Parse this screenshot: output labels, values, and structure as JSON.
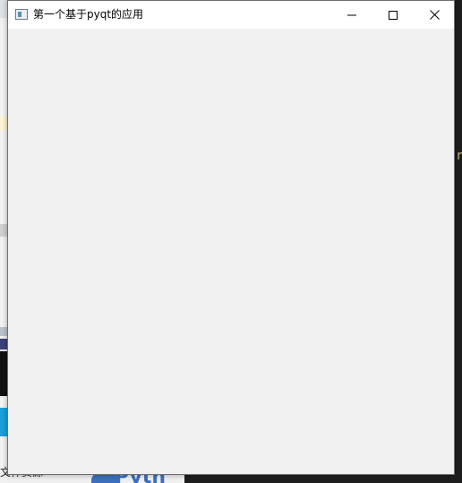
{
  "window": {
    "title": "第一个基于pyqt的应用",
    "icon": "app-window-icon",
    "controls": {
      "minimize_icon": "minimize-icon",
      "maximize_icon": "maximize-icon",
      "close_icon": "close-icon"
    }
  },
  "background": {
    "right_edge_char": "r",
    "bottom_text": "文件资源",
    "bottom_logo_text": "Pyth"
  },
  "colors": {
    "window_bg": "#f0f0f0",
    "titlebar_bg": "#ffffff",
    "border": "#6f6f6f"
  }
}
